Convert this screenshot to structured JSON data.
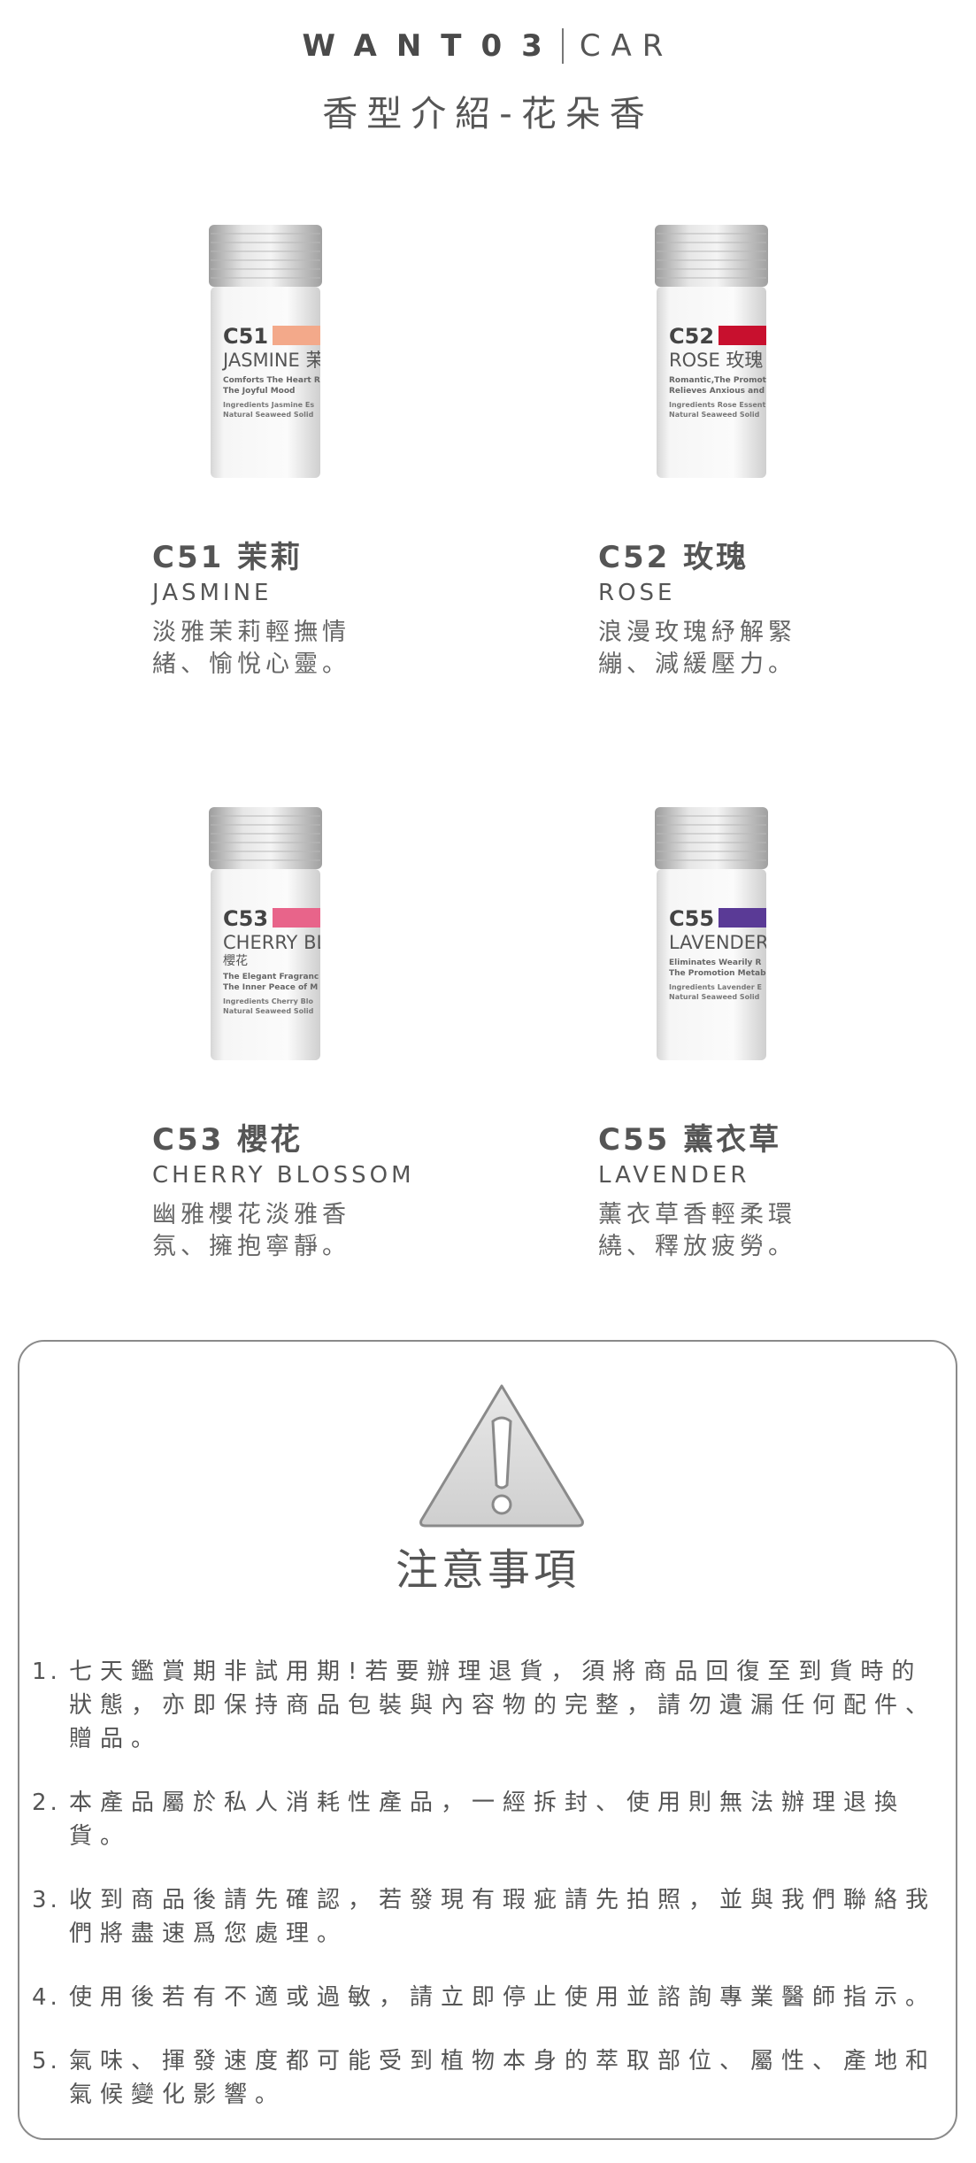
{
  "header": {
    "brand": "WANT03",
    "category": "CAR",
    "subtitle": "香型介紹-花朵香"
  },
  "products": [
    {
      "code": "C51 茉莉",
      "en": "JASMINE",
      "desc": "淡雅茉莉輕撫情緒、愉悅心靈。",
      "label_code": "C51",
      "label_name": "JASMINE 茉",
      "label_line1": "Comforts The Heart R",
      "label_line2": "The Joyful Mood",
      "label_line3": "Ingredients Jasmine Es",
      "label_line4": "Natural Seaweed Solid",
      "color": "#f3a98a"
    },
    {
      "code": "C52 玫瑰",
      "en": "ROSE",
      "desc": "浪漫玫瑰紓解緊繃、減緩壓力。",
      "label_code": "C52",
      "label_name": "ROSE 玫瑰",
      "label_line1": "Romantic,The Promoti",
      "label_line2": "Relieves Anxious and T",
      "label_line3": "Ingredients Rose Essent",
      "label_line4": "Natural Seaweed Solid",
      "color": "#c8102e"
    },
    {
      "code": "C53 櫻花",
      "en": "CHERRY BLOSSOM",
      "desc": "幽雅櫻花淡雅香氛、擁抱寧靜。",
      "label_code": "C53",
      "label_name": "CHERRY BL",
      "label_sub": "櫻花",
      "label_line1": "The Elegant Fragranc",
      "label_line2": "The Inner Peace of M",
      "label_line3": "Ingredients Cherry Blo",
      "label_line4": "Natural Seaweed Solid",
      "color": "#e8648a"
    },
    {
      "code": "C55 薰衣草",
      "en": "LAVENDER",
      "desc": "薰衣草香輕柔環繞、釋放疲勞。",
      "label_code": "C55",
      "label_name": "LAVENDER",
      "label_line1": "Eliminates Wearily R",
      "label_line2": "The Promotion Metab",
      "label_line3": "Ingredients Lavender E",
      "label_line4": "Natural Seaweed Solid",
      "color": "#5a3a96"
    }
  ],
  "notice": {
    "title": "注意事項",
    "icon": "warning-triangle-icon",
    "items": [
      {
        "num": "1.",
        "text": "七天鑑賞期非試用期!若要辦理退貨，須將商品回復至到貨時的狀態，亦即保持商品包裝與內容物的完整，請勿遺漏任何配件、贈品。"
      },
      {
        "num": "2.",
        "text": "本產品屬於私人消耗性產品，一經拆封、使用則無法辦理退換貨。"
      },
      {
        "num": "3.",
        "text": "收到商品後請先確認，若發現有瑕疵請先拍照，並與我們聯絡我們將盡速爲您處理。"
      },
      {
        "num": "4.",
        "text": "使用後若有不適或過敏，請立即停止使用並諮詢專業醫師指示。"
      },
      {
        "num": "5.",
        "text": "氣味、揮發速度都可能受到植物本身的萃取部位、屬性、產地和氣候變化影響。"
      }
    ]
  }
}
